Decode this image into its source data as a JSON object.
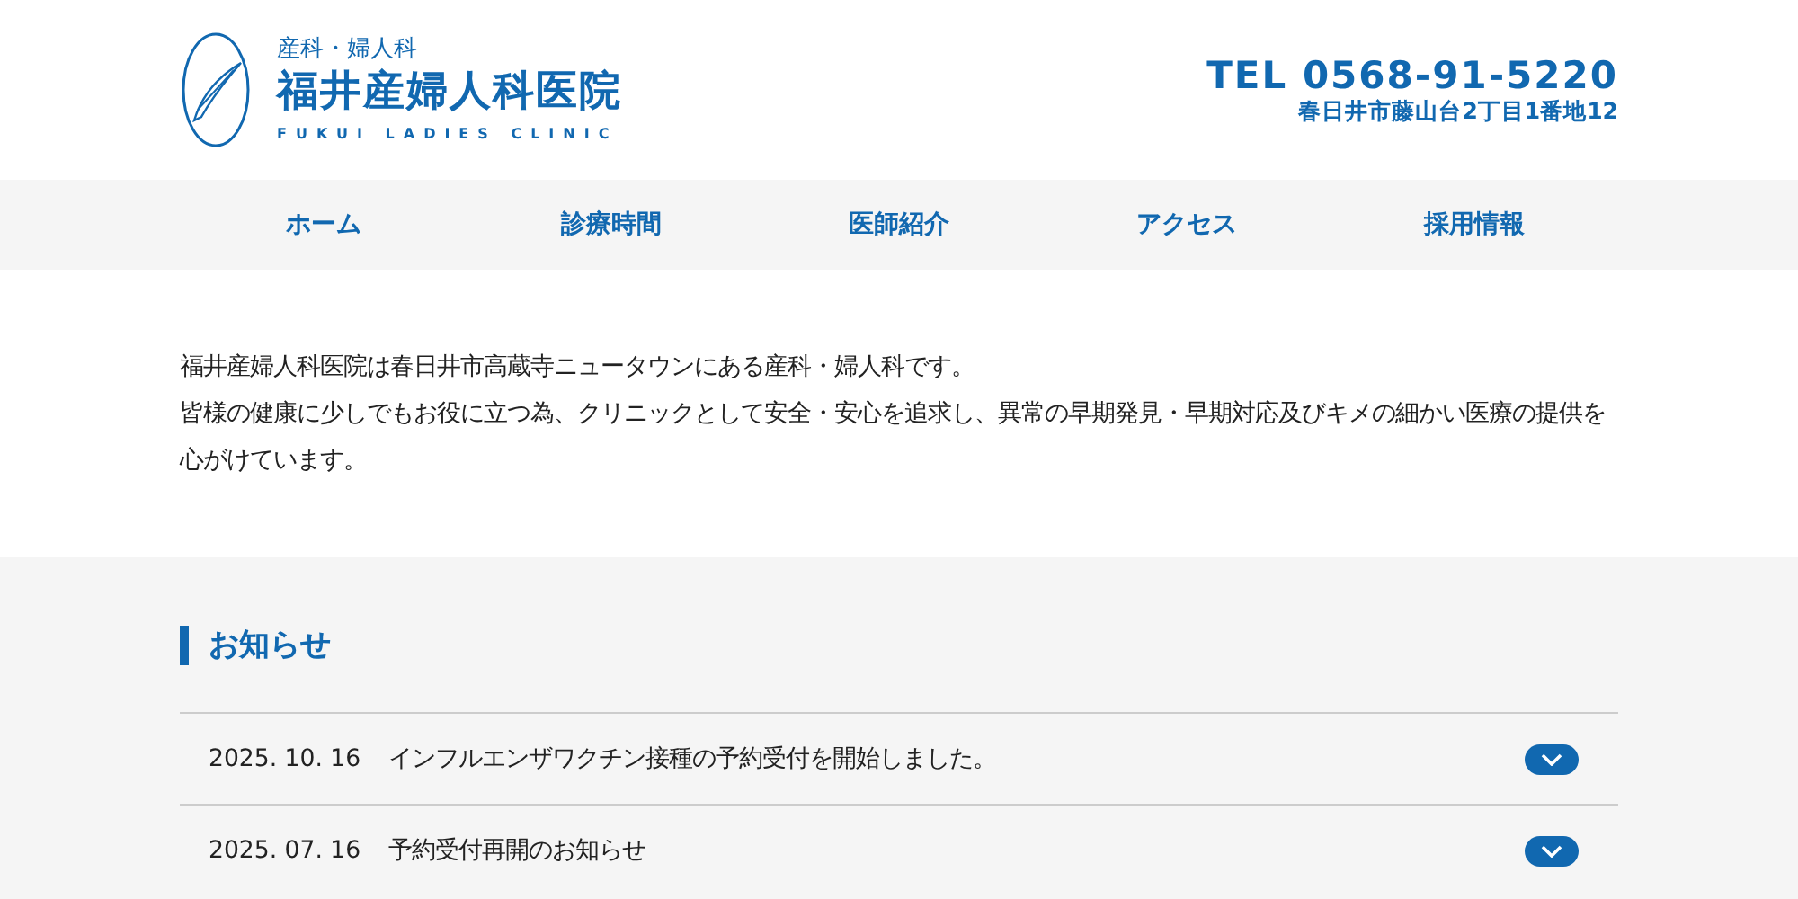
{
  "header": {
    "logo_subtitle": "産科・婦人科",
    "logo_title": "福井産婦人科医院",
    "logo_english": "FUKUI LADIES CLINIC",
    "phone": "TEL 0568-91-5220",
    "address": "春日井市藤山台2丁目1番地12"
  },
  "nav": {
    "items": [
      {
        "label": "ホーム"
      },
      {
        "label": "診療時間"
      },
      {
        "label": "医師紹介"
      },
      {
        "label": "アクセス"
      },
      {
        "label": "採用情報"
      }
    ]
  },
  "intro": {
    "paragraphs": [
      "福井産婦人科医院は春日井市高蔵寺ニュータウンにある産科・婦人科です。",
      "皆様の健康に少しでもお役に立つ為、クリニックとして安全・安心を追求し、異常の早期発見・早期対応及びキメの細かい医療の提供を心がけています。"
    ]
  },
  "news": {
    "heading": "お知らせ",
    "items": [
      {
        "date": "2025. 10. 16",
        "title": "インフルエンザワクチン接種の予約受付を開始しました。",
        "expanded": false
      },
      {
        "date": "2025. 07. 16",
        "title": "予約受付再開のお知らせ",
        "expanded": false
      }
    ]
  }
}
